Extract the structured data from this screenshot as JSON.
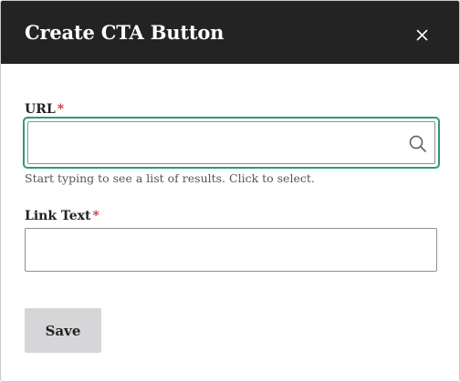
{
  "dialog": {
    "title": "Create CTA Button",
    "close_icon": "close-icon"
  },
  "form": {
    "url": {
      "label": "URL",
      "required_marker": "*",
      "value": "",
      "placeholder": "",
      "help_text": "Start typing to see a list of results. Click to select.",
      "icon": "search-icon",
      "focused": true
    },
    "link_text": {
      "label": "Link Text",
      "required_marker": "*",
      "value": "",
      "placeholder": ""
    },
    "save_label": "Save"
  },
  "colors": {
    "header_bg": "#232323",
    "focus_ring": "#2f9a6e",
    "required": "#d0312d",
    "button_bg": "#d6d6d9"
  }
}
